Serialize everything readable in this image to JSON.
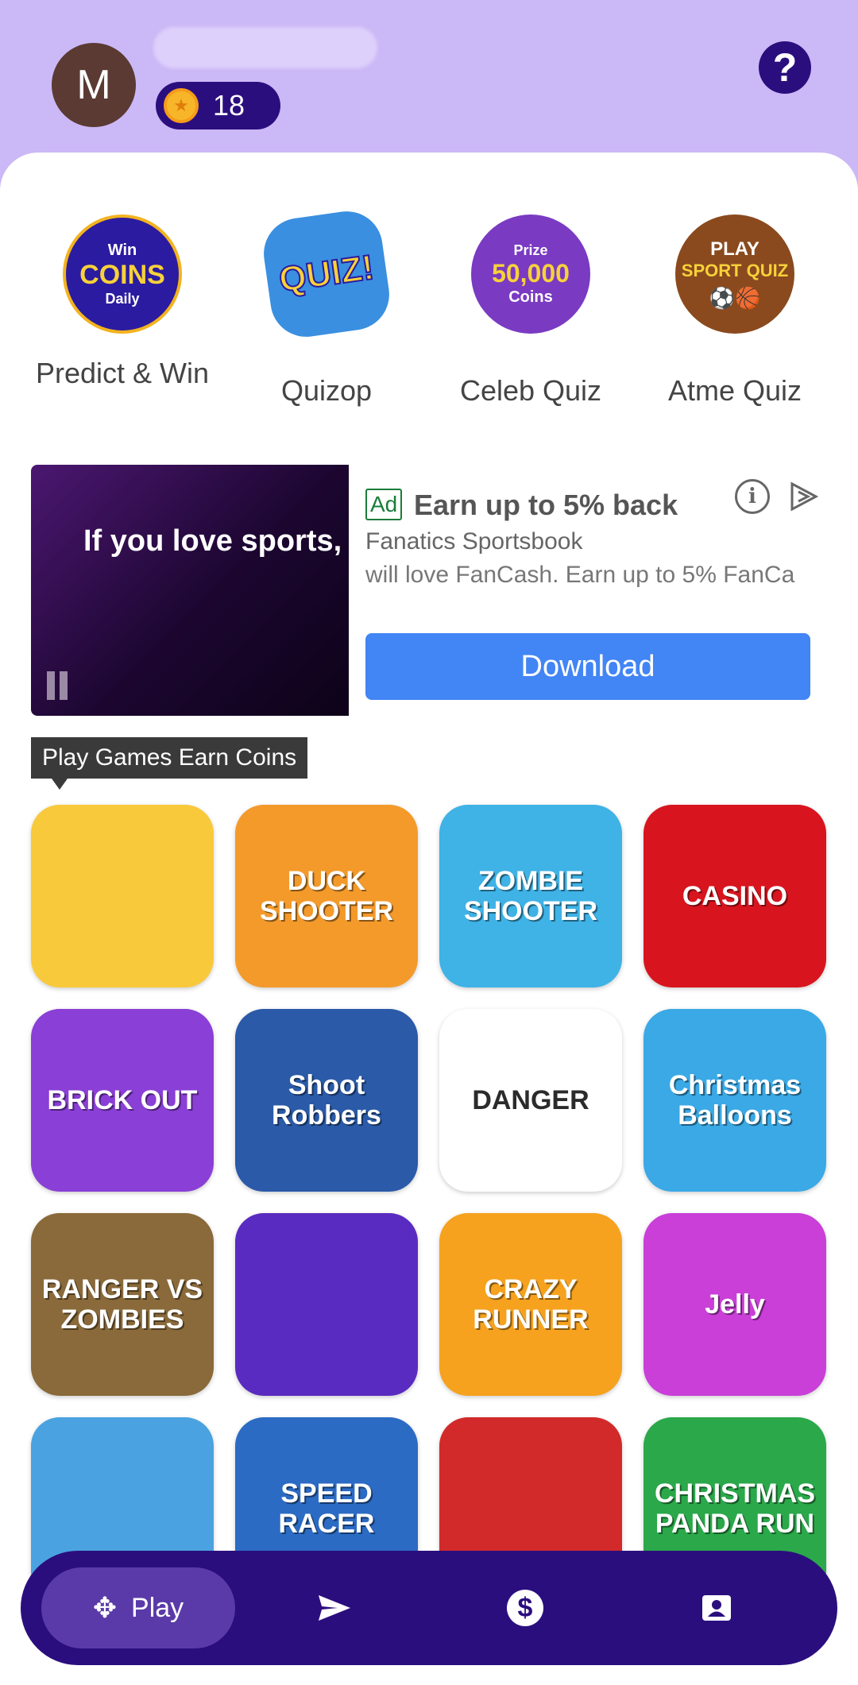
{
  "header": {
    "avatar_initial": "M",
    "coins": "18",
    "help_symbol": "?"
  },
  "quizzes": [
    {
      "label": "Predict & Win",
      "icon": "win-coins-daily-icon",
      "icon_lines": [
        "Win",
        "COINS",
        "Daily"
      ]
    },
    {
      "label": "Quizop",
      "icon": "quiz-burst-icon",
      "icon_lines": [
        "QUIZ!"
      ]
    },
    {
      "label": "Celeb Quiz",
      "icon": "prize-coins-icon",
      "icon_lines": [
        "Prize",
        "50,000",
        "Coins"
      ]
    },
    {
      "label": "Atme Quiz",
      "icon": "sport-quiz-icon",
      "icon_lines": [
        "PLAY",
        "SPORT QUIZ"
      ]
    }
  ],
  "ad": {
    "badge": "Ad",
    "title": "Earn up to 5% back",
    "advertiser": "Fanatics Sportsbook",
    "body": "will love FanCash. Earn up to 5% FanCa",
    "cta": "Download",
    "video_text": "If you love sports,",
    "info_symbol": "i"
  },
  "section": {
    "tooltip": "Play Games Earn Coins"
  },
  "games": [
    {
      "title": "",
      "icon": "candy-chef-icon",
      "color": "#f9c93c"
    },
    {
      "title": "DUCK SHOOTER",
      "icon": "duck-shooter-icon",
      "color": "#f39a2b"
    },
    {
      "title": "ZOMBIE SHOOTER",
      "icon": "zombie-shooter-icon",
      "color": "#3fb2e6"
    },
    {
      "title": "CASINO",
      "icon": "casino-icon",
      "color": "#d8151e"
    },
    {
      "title": "BRICK OUT",
      "icon": "brick-out-icon",
      "color": "#8a3fd6"
    },
    {
      "title": "Shoot Robbers",
      "icon": "shoot-robbers-icon",
      "color": "#2a5aa8"
    },
    {
      "title": "DANGER",
      "icon": "danger-icon",
      "color": "#ffffff"
    },
    {
      "title": "Christmas Balloons",
      "icon": "christmas-balloons-icon",
      "color": "#3aa9e6"
    },
    {
      "title": "RANGER VS ZOMBIES",
      "icon": "ranger-zombies-icon",
      "color": "#8a6a3a"
    },
    {
      "title": "",
      "icon": "bubble-skull-icon",
      "color": "#5a2bc0"
    },
    {
      "title": "CRAZY RUNNER",
      "icon": "crazy-runner-icon",
      "color": "#f6a21e"
    },
    {
      "title": "Jelly",
      "icon": "jelly-icon",
      "color": "#c93fd8"
    },
    {
      "title": "",
      "icon": "airplane-icon",
      "color": "#4aa3e0"
    },
    {
      "title": "SPEED RACER",
      "icon": "speed-racer-icon",
      "color": "#2b6bc4"
    },
    {
      "title": "",
      "icon": "car-puzzle-icon",
      "color": "#d22a2a"
    },
    {
      "title": "CHRISTMAS PANDA RUN",
      "icon": "panda-run-icon",
      "color": "#2aa84a"
    }
  ],
  "nav": {
    "play_label": "Play",
    "items": [
      "play-icon",
      "send-icon",
      "dollar-icon",
      "profile-icon"
    ]
  },
  "colors": {
    "header_bg": "#cbb8f6",
    "primary": "#2b0e7e",
    "cta": "#4285f4"
  }
}
